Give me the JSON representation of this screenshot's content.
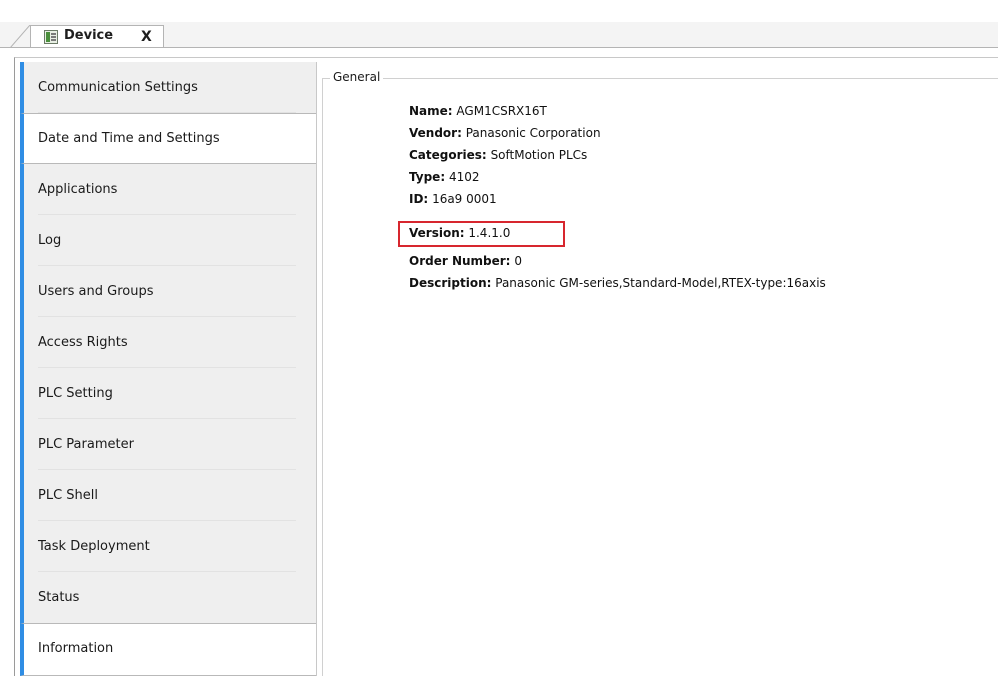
{
  "tab": {
    "title": "Device",
    "close_glyph": "X",
    "icon": "device-icon"
  },
  "sidebar": {
    "items": [
      {
        "label": "Communication Settings"
      },
      {
        "label": "Date and Time and Settings",
        "selected": true
      },
      {
        "label": "Applications"
      },
      {
        "label": "Log"
      },
      {
        "label": "Users and Groups"
      },
      {
        "label": "Access Rights"
      },
      {
        "label": "PLC Setting"
      },
      {
        "label": "PLC Parameter"
      },
      {
        "label": "PLC Shell"
      },
      {
        "label": "Task Deployment"
      },
      {
        "label": "Status"
      },
      {
        "label": "Information",
        "selected": true
      }
    ]
  },
  "general": {
    "group_label": "General",
    "fields": [
      {
        "label": "Name:",
        "value": "AGM1CSRX16T"
      },
      {
        "label": "Vendor:",
        "value": "Panasonic Corporation"
      },
      {
        "label": "Categories:",
        "value": "SoftMotion PLCs"
      },
      {
        "label": "Type:",
        "value": "4102"
      },
      {
        "label": "ID:",
        "value": "16a9 0001"
      },
      {
        "label": "Version:",
        "value": "1.4.1.0",
        "highlighted": true
      },
      {
        "label": "Order Number:",
        "value": "0"
      },
      {
        "label": "Description:",
        "value": "Panasonic GM-series,Standard-Model,RTEX-type:16axis"
      }
    ]
  },
  "colors": {
    "accent": "#2f8de4",
    "highlight": "#d7262e"
  }
}
